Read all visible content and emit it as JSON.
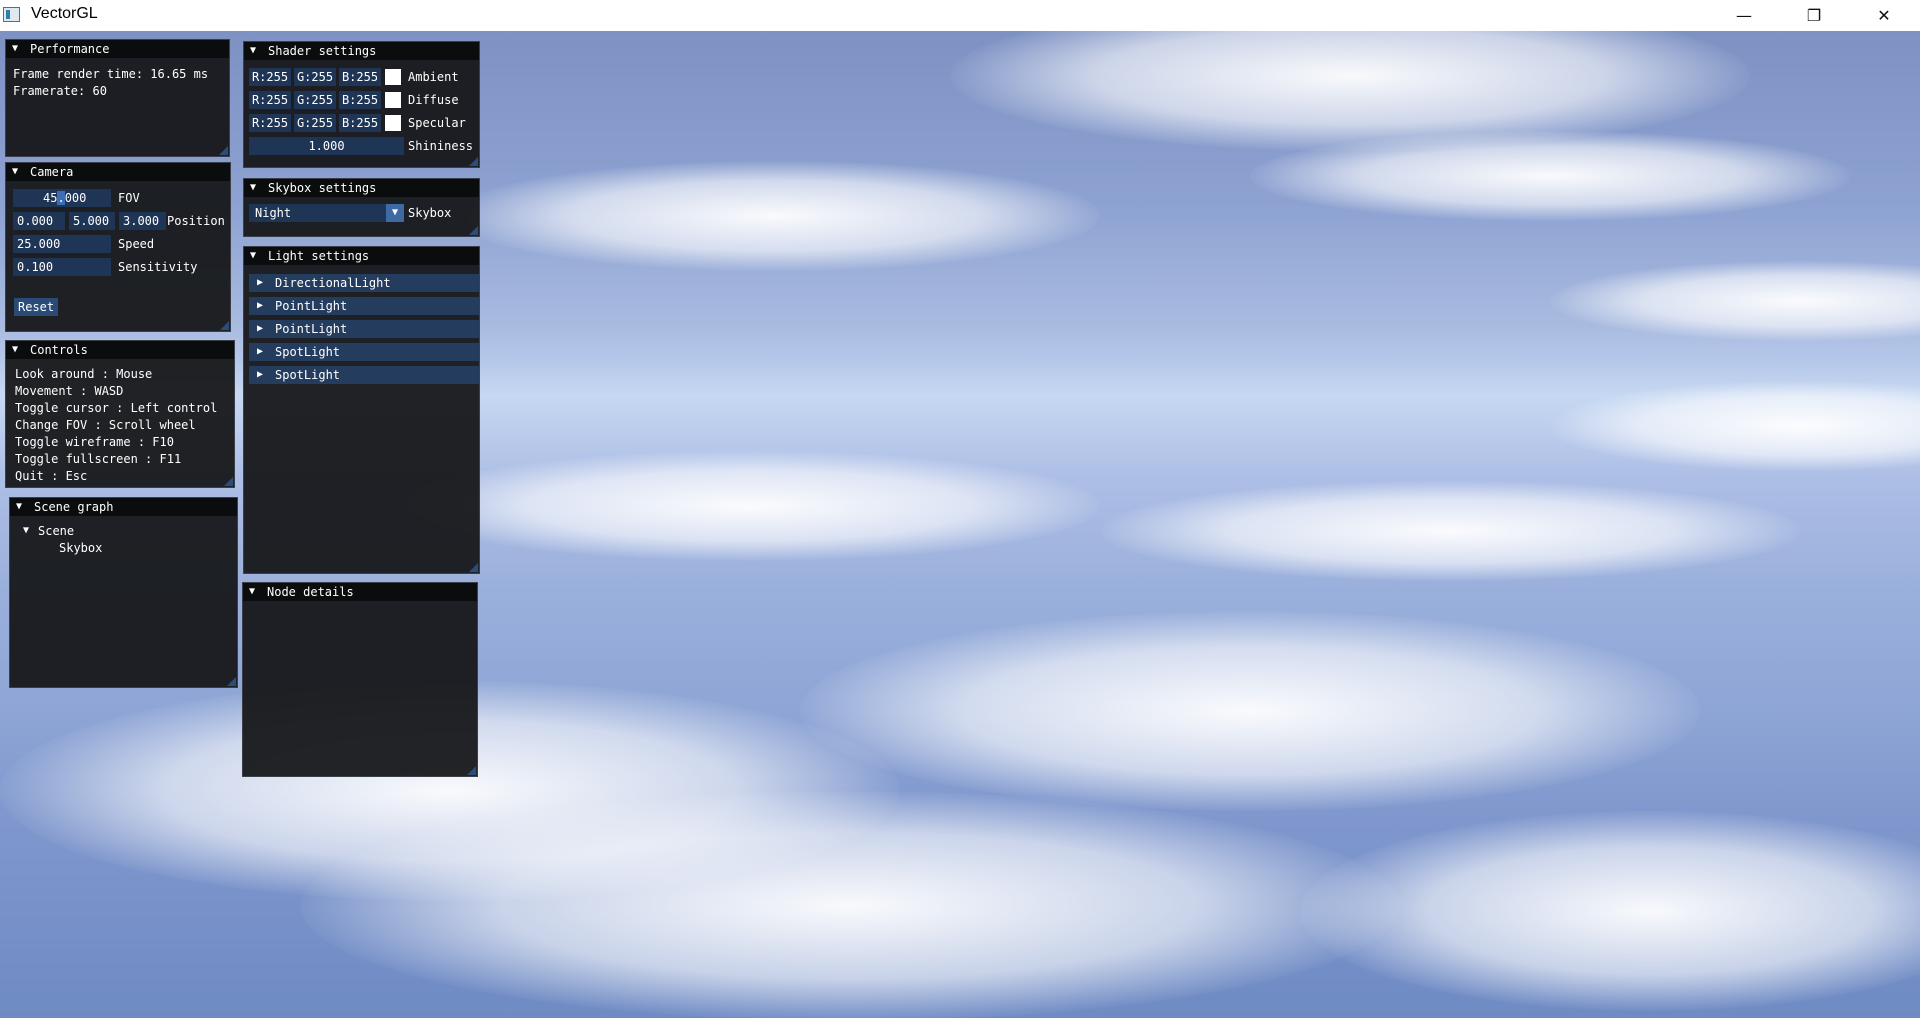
{
  "window": {
    "title": "VectorGL",
    "icons": {
      "app": "app-icon",
      "minimize": "minimize-icon",
      "maximize": "restore-icon",
      "close": "close-icon"
    },
    "glyphs": {
      "minimize": "—",
      "maximize": "❐",
      "close": "✕"
    }
  },
  "performance": {
    "title": "Performance",
    "frame_time": "Frame render time: 16.65 ms",
    "framerate": "Framerate: 60"
  },
  "camera": {
    "title": "Camera",
    "fov_value_a": "45",
    "fov_value_b": ".",
    "fov_value_c": "000",
    "fov_label": "FOV",
    "position": [
      "0.000",
      "5.000",
      "3.000"
    ],
    "position_label": "Position",
    "speed_value": "25.000",
    "speed_label": "Speed",
    "sensitivity_value": "0.100",
    "sensitivity_label": "Sensitivity",
    "reset_label": "Reset"
  },
  "controls": {
    "title": "Controls",
    "lines": [
      "Look around : Mouse",
      "Movement : WASD",
      "Toggle cursor : Left control",
      "Change FOV : Scroll wheel",
      "Toggle wireframe : F10",
      "Toggle fullscreen : F11",
      "Quit : Esc"
    ]
  },
  "scene_graph": {
    "title": "Scene graph",
    "root": "Scene",
    "child": "Skybox"
  },
  "shader": {
    "title": "Shader settings",
    "rows": [
      {
        "r": "R:255",
        "g": "G:255",
        "b": "B:255",
        "label": "Ambient",
        "color": "#ffffff"
      },
      {
        "r": "R:255",
        "g": "G:255",
        "b": "B:255",
        "label": "Diffuse",
        "color": "#ffffff"
      },
      {
        "r": "R:255",
        "g": "G:255",
        "b": "B:255",
        "label": "Specular",
        "color": "#ffffff"
      }
    ],
    "shininess_value": "1.000",
    "shininess_label": "Shininess"
  },
  "skybox": {
    "title": "Skybox settings",
    "selected": "Night",
    "label": "Skybox"
  },
  "lights": {
    "title": "Light settings",
    "items": [
      "DirectionalLight",
      "PointLight",
      "PointLight",
      "SpotLight",
      "SpotLight"
    ]
  },
  "node_details": {
    "title": "Node details"
  },
  "colors": {
    "panel_bg": "#151618",
    "header_bg": "#0b0c0d",
    "field_bg": "#1f3555",
    "accent": "#2a4b78",
    "sky_top": "#7d91c3",
    "sky_horizon": "#c6d8f2"
  }
}
